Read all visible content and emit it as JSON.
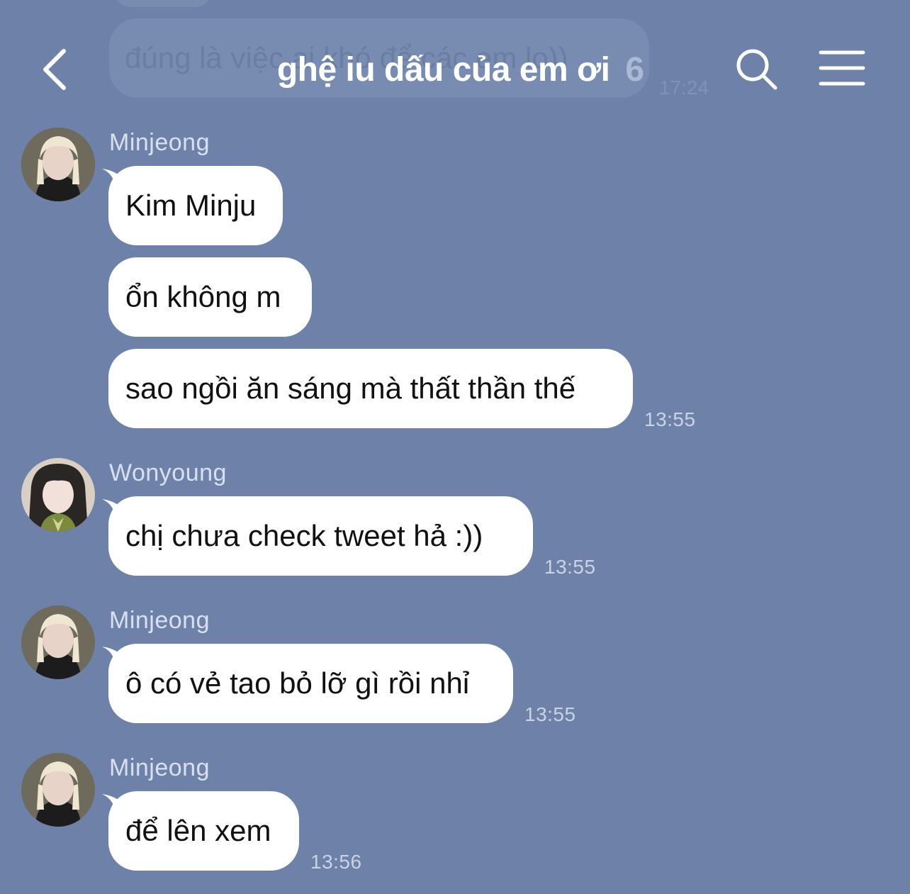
{
  "header": {
    "title": "ghệ iu dấu của em ơi",
    "member_count": "6"
  },
  "ghost_message": {
    "text": "đúng là việc ai khó để các em lo))",
    "time": "17:24"
  },
  "messages": [
    {
      "sender": "Minjeong",
      "bubbles": [
        "Kim Minju",
        "ổn không m",
        "sao ngồi ăn sáng mà thất thần thế"
      ],
      "time": "13:55"
    },
    {
      "sender": "Wonyoung",
      "bubbles": [
        "chị chưa check tweet hả :))"
      ],
      "time": "13:55"
    },
    {
      "sender": "Minjeong",
      "bubbles": [
        "ô có vẻ tao bỏ lỡ gì rồi nhỉ"
      ],
      "time": "13:55"
    },
    {
      "sender": "Minjeong",
      "bubbles": [
        "để lên xem"
      ],
      "time": "13:56"
    }
  ],
  "colors": {
    "background": "#6e82a9",
    "bubble": "#ffffff",
    "sender_name": "#d8e0ee",
    "timestamp": "#c9d3e5"
  },
  "icons": [
    "back-chevron-icon",
    "search-icon",
    "menu-icon"
  ]
}
